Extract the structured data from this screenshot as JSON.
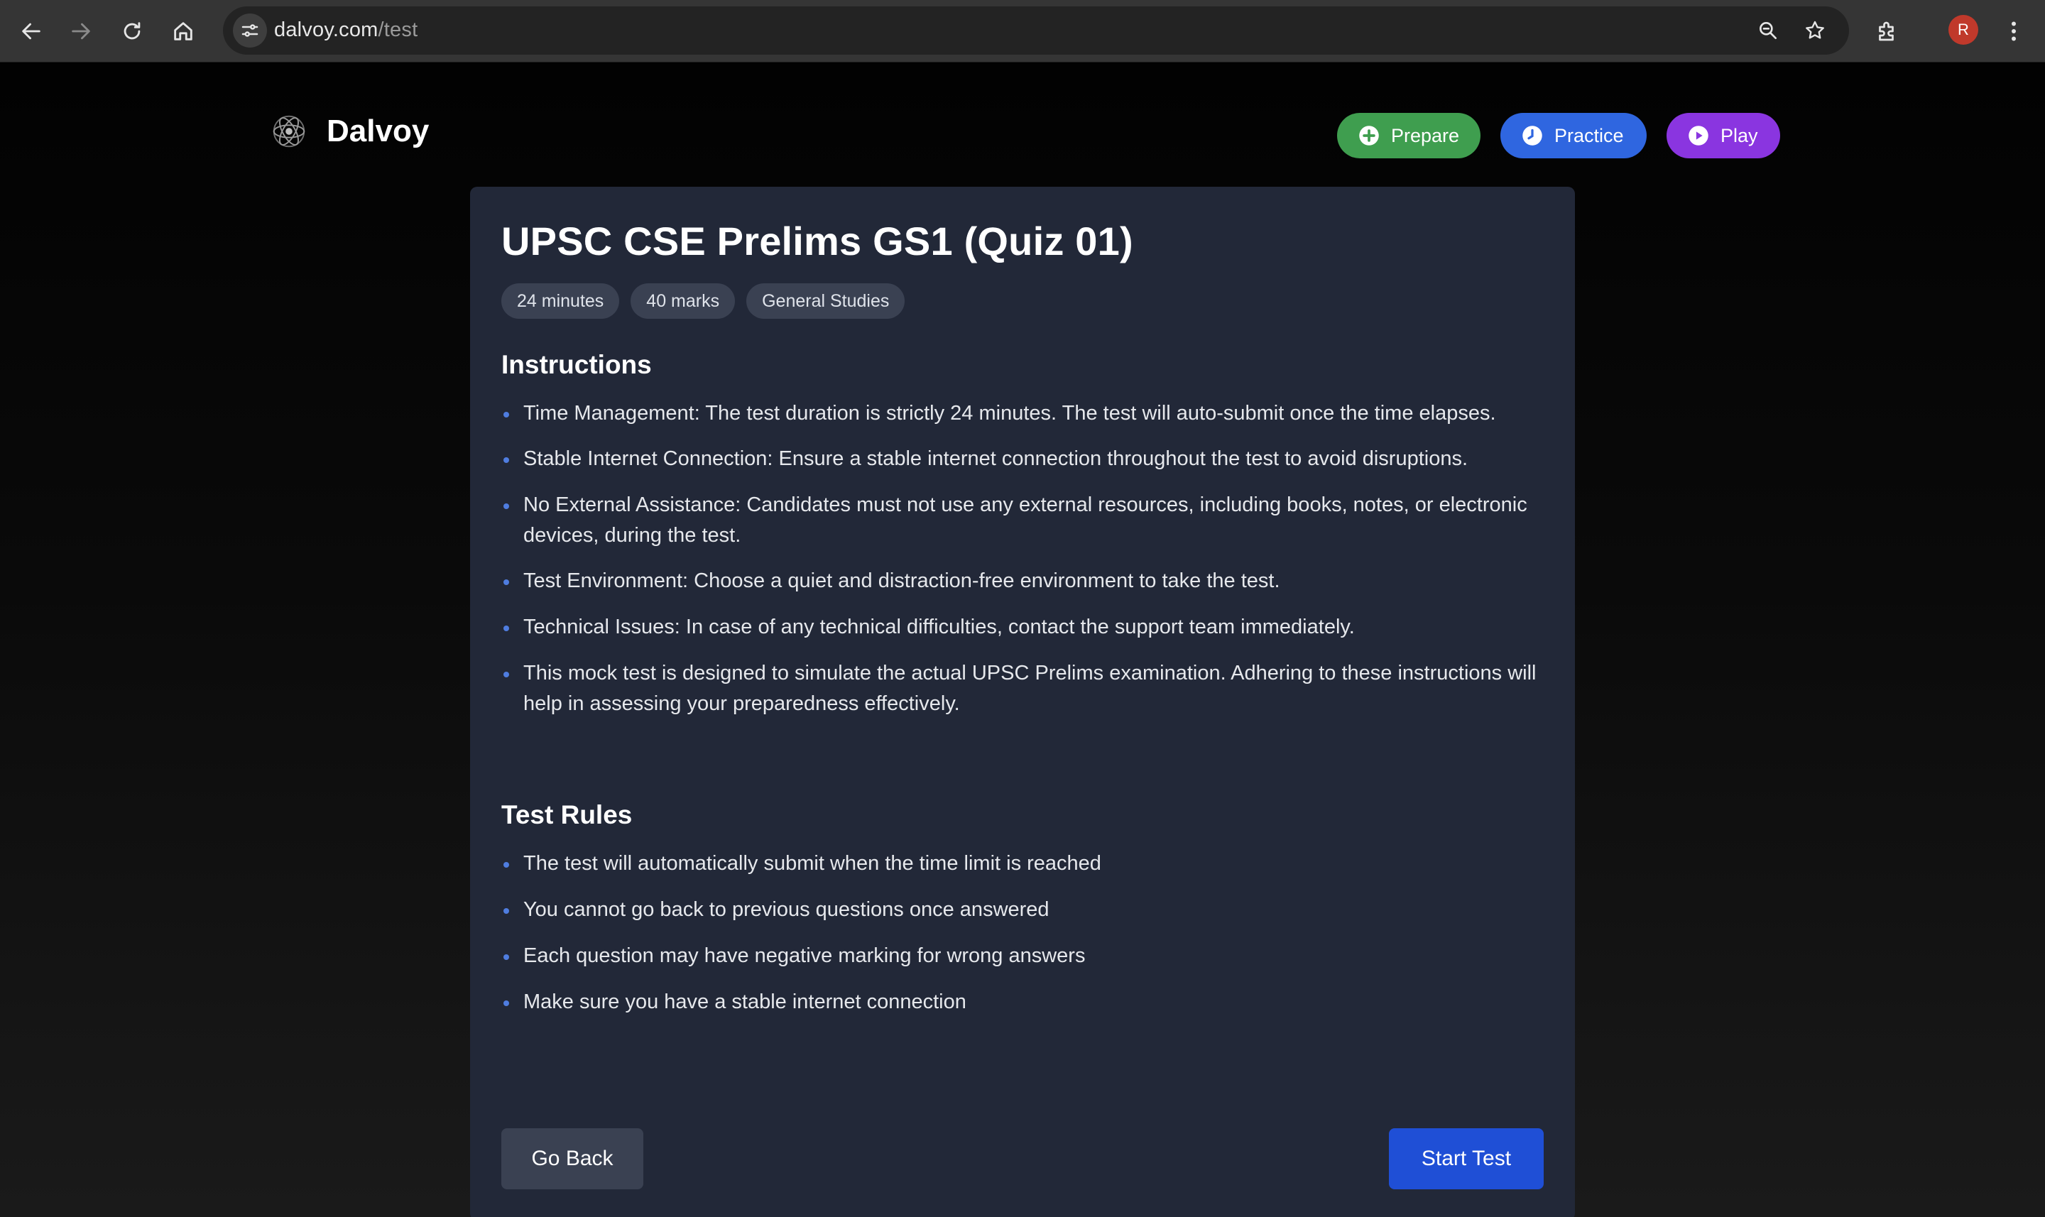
{
  "browser": {
    "url_host": "dalvoy.com",
    "url_path": "/test",
    "profile_initial": "R",
    "icons": [
      "back-arrow-icon",
      "forward-arrow-icon",
      "reload-icon",
      "home-icon",
      "site-info-icon",
      "zoom-icon",
      "bookmark-star-icon",
      "extensions-icon",
      "more-vert-icon"
    ]
  },
  "header": {
    "brand": "Dalvoy",
    "nav": [
      {
        "label": "Prepare",
        "icon": "plus-circle-icon",
        "color": "#3f9e4f"
      },
      {
        "label": "Practice",
        "icon": "clock-icon",
        "color": "#2f66e0"
      },
      {
        "label": "Play",
        "icon": "play-circle-icon",
        "color": "#8a35e0"
      }
    ]
  },
  "test": {
    "title": "UPSC CSE Prelims GS1 (Quiz 01)",
    "tags": [
      "24 minutes",
      "40 marks",
      "General Studies"
    ],
    "instructions_heading": "Instructions",
    "instructions": [
      "Time Management: The test duration is strictly 24 minutes. The test will auto-submit once the time elapses.",
      "Stable Internet Connection: Ensure a stable internet connection throughout the test to avoid disruptions.",
      "No External Assistance: Candidates must not use any external resources, including books, notes, or electronic devices, during the test.",
      "Test Environment: Choose a quiet and distraction-free environment to take the test.",
      "Technical Issues: In case of any technical difficulties, contact the support team immediately.",
      "This mock test is designed to simulate the actual UPSC Prelims examination. Adhering to these instructions will help in assessing your preparedness effectively."
    ],
    "rules_heading": "Test Rules",
    "rules": [
      "The test will automatically submit when the time limit is reached",
      "You cannot go back to previous questions once answered",
      "Each question may have negative marking for wrong answers",
      "Make sure you have a stable internet connection"
    ],
    "back_label": "Go Back",
    "start_label": "Start Test"
  },
  "colors": {
    "page_bg": "#000000",
    "card_bg": "#222838",
    "tag_bg": "#3a4152",
    "bullet": "#4f7de0",
    "start_button": "#1f4fd6"
  }
}
